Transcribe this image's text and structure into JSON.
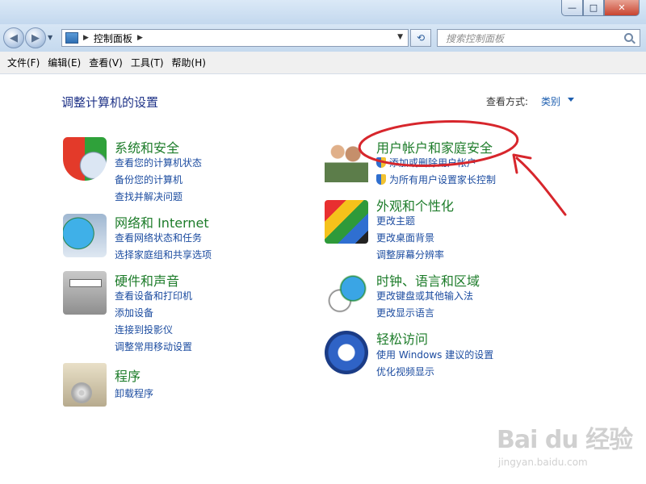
{
  "window": {
    "minimize_glyph": "—",
    "maximize_glyph": "□",
    "close_glyph": "✕"
  },
  "nav": {
    "back_glyph": "◀",
    "forward_glyph": "▶",
    "history_glyph": "▼",
    "address_sep1": "▶",
    "address_text": "控制面板",
    "address_sep2": "▶",
    "address_drop": "▼",
    "refresh_glyph": "⟲",
    "search_placeholder": "搜索控制面板"
  },
  "menu": [
    "文件(F)",
    "编辑(E)",
    "查看(V)",
    "工具(T)",
    "帮助(H)"
  ],
  "main": {
    "title": "调整计算机的设置",
    "view_by_label": "查看方式:",
    "view_by_value": "类别"
  },
  "categories": {
    "security": {
      "icon": "shield-icon",
      "title": "系统和安全",
      "links": [
        "查看您的计算机状态",
        "备份您的计算机",
        "查找并解决问题"
      ]
    },
    "network": {
      "icon": "network-globe-icon",
      "title": "网络和 Internet",
      "links": [
        "查看网络状态和任务",
        "选择家庭组和共享选项"
      ]
    },
    "hardware": {
      "icon": "printer-icon",
      "title": "硬件和声音",
      "links": [
        "查看设备和打印机",
        "添加设备",
        "连接到投影仪",
        "调整常用移动设置"
      ]
    },
    "programs": {
      "icon": "programs-disc-icon",
      "title": "程序",
      "links": [
        "卸载程序"
      ]
    },
    "users": {
      "icon": "users-icon",
      "title": "用户帐户和家庭安全",
      "links": [
        "添加或删除用户帐户",
        "为所有用户设置家长控制"
      ]
    },
    "appearance": {
      "icon": "display-palette-icon",
      "title": "外观和个性化",
      "links": [
        "更改主题",
        "更改桌面背景",
        "调整屏幕分辨率"
      ]
    },
    "clock": {
      "icon": "clock-globe-icon",
      "title": "时钟、语言和区域",
      "links": [
        "更改键盘或其他输入法",
        "更改显示语言"
      ]
    },
    "ease": {
      "icon": "ease-of-access-icon",
      "title": "轻松访问",
      "links": [
        "使用 Windows 建议的设置",
        "优化视频显示"
      ]
    }
  },
  "watermark": {
    "logo": "Bai du 经验",
    "url": "jingyan.baidu.com"
  },
  "colors": {
    "category_title": "#1d7c2a",
    "link": "#1c4ca0",
    "annotation": "#d7262c"
  }
}
